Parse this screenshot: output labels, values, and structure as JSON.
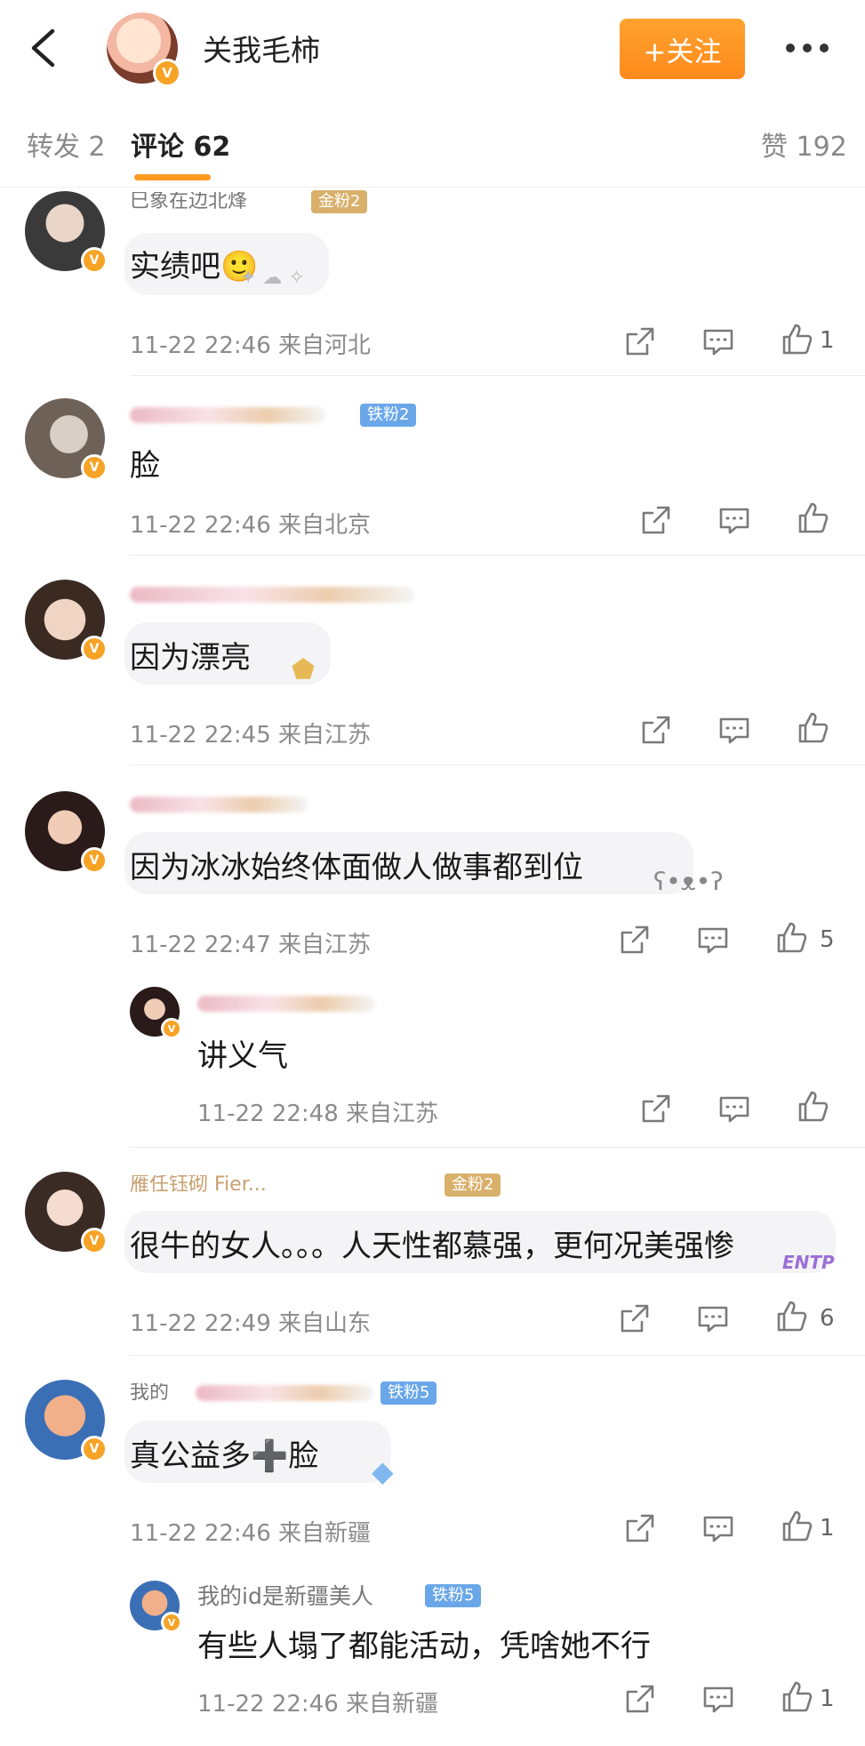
{
  "header": {
    "back_icon": "chevron-left-icon",
    "avatar_badge": "V",
    "title": "关我毛柿",
    "follow_label": "+关注",
    "more_icon": "more-dots-icon",
    "accent": "#ff9a21"
  },
  "tabs": {
    "repost": "转发 2",
    "comments": "评论 62",
    "likes": "赞 192"
  },
  "comments": [
    {
      "username": "巳象在边北烽",
      "fan_badge": "金粉2",
      "text": "实绩吧🙂",
      "meta": "11-22 22:46 来自河北",
      "like_count": "1"
    },
    {
      "username": "",
      "fan_badge": "铁粉2",
      "text": "脸",
      "meta": "11-22 22:46 来自北京",
      "like_count": ""
    },
    {
      "username": "",
      "fan_badge": "",
      "text": "因为漂亮",
      "meta": "11-22 22:45 来自江苏",
      "like_count": ""
    },
    {
      "username": "",
      "fan_badge": "",
      "text": "因为冰冰始终体面做人做事都到位",
      "meta": "11-22 22:47 来自江苏",
      "like_count": "5"
    },
    {
      "username": "",
      "fan_badge": "",
      "text": "讲义气",
      "meta": "11-22 22:48 来自江苏",
      "like_count": ""
    },
    {
      "username": "雁任钰砌 Fier...",
      "fan_badge": "金粉2",
      "text": "很牛的女人。。。人天性都慕强，更何况美强惨",
      "meta": "11-22 22:49 来自山东",
      "like_count": "6",
      "sticker": "ENTP"
    },
    {
      "username": "我的",
      "fan_badge": "铁粉5",
      "text": "真公益多➕脸",
      "meta": "11-22 22:46 来自新疆",
      "like_count": "1"
    },
    {
      "username": "我的id是新疆美人",
      "fan_badge": "铁粉5",
      "text": "有些人塌了都能活动，凭啥她不行",
      "meta": "11-22 22:46 来自新疆",
      "like_count": "1"
    }
  ]
}
